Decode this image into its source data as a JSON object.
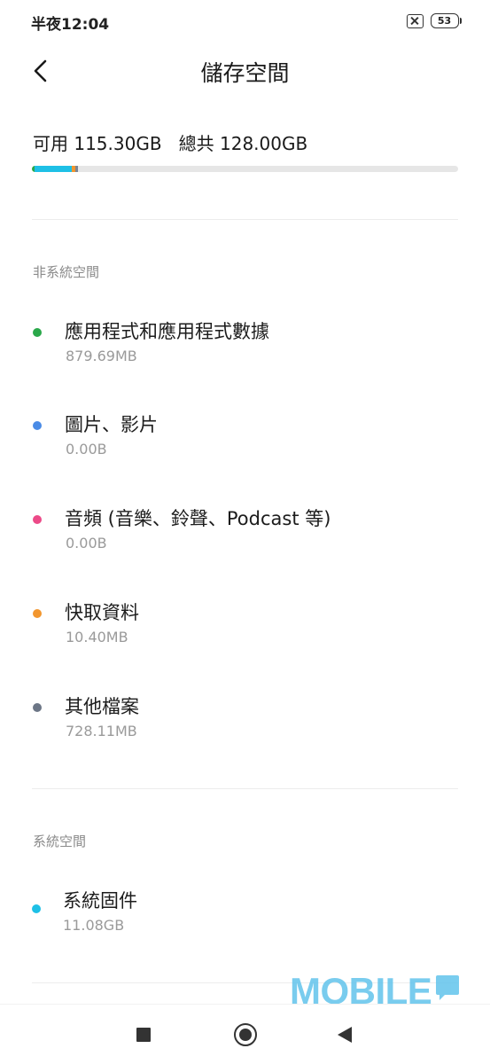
{
  "status_bar": {
    "time": "半夜12:04",
    "battery": "53"
  },
  "header": {
    "title": "儲存空間"
  },
  "summary": {
    "available_label": "可用",
    "available_value": "115.30GB",
    "total_label": "總共",
    "total_value": "128.00GB"
  },
  "usage_bar": {
    "track_color": "#e6e6e6",
    "segments": [
      {
        "name": "apps",
        "color": "#2aa84a",
        "fraction": 0.0069
      },
      {
        "name": "system",
        "color": "#1ec0e6",
        "fraction": 0.0866
      },
      {
        "name": "cache",
        "color": "#f2962e",
        "fraction": 0.0081
      },
      {
        "name": "other",
        "color": "#7c8594",
        "fraction": 0.0057
      }
    ]
  },
  "non_system": {
    "title": "非系統空間",
    "items": [
      {
        "label": "應用程式和應用程式數據",
        "size": "879.69MB",
        "color": "#2aa84a"
      },
      {
        "label": "圖片、影片",
        "size": "0.00B",
        "color": "#4a8be6"
      },
      {
        "label": "音頻 (音樂、鈴聲、Podcast 等)",
        "size": "0.00B",
        "color": "#ec4a88"
      },
      {
        "label": "快取資料",
        "size": "10.40MB",
        "color": "#f2962e"
      },
      {
        "label": "其他檔案",
        "size": "728.11MB",
        "color": "#6c7686"
      }
    ]
  },
  "system": {
    "title": "系統空間",
    "items": [
      {
        "label": "系統固件",
        "size": "11.08GB",
        "color": "#1ec0e6"
      }
    ]
  },
  "watermark": {
    "text": "MOBILE"
  }
}
